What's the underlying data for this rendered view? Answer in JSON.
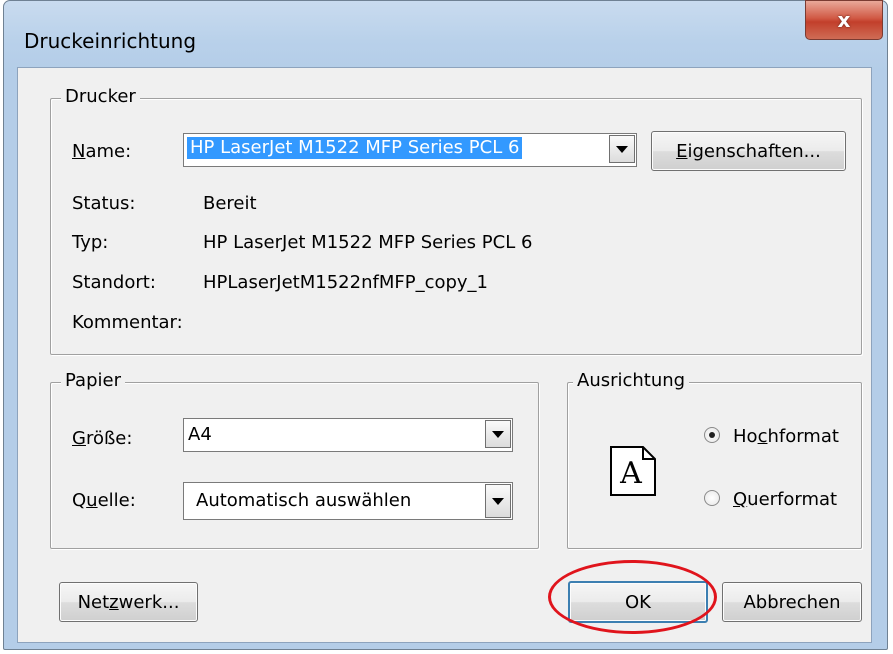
{
  "window": {
    "title": "Druckeinrichtung",
    "close_symbol": "x"
  },
  "printer_group": {
    "legend": "Drucker",
    "name_label": "Name:",
    "name_value": "HP LaserJet M1522 MFP Series PCL 6",
    "properties_button": "Eigenschaften...",
    "status_label": "Status:",
    "status_value": "Bereit",
    "type_label": "Typ:",
    "type_value": "HP LaserJet M1522 MFP Series PCL 6",
    "location_label": "Standort:",
    "location_value": "HPLaserJetM1522nfMFP_copy_1",
    "comment_label": "Kommentar:",
    "comment_value": ""
  },
  "paper_group": {
    "legend": "Papier",
    "size_label": "Größe:",
    "size_value": "A4",
    "source_label": "Quelle:",
    "source_value": "Automatisch auswählen"
  },
  "orientation_group": {
    "legend": "Ausrichtung",
    "page_icon_letter": "A",
    "portrait_label": "Hochformat",
    "landscape_label": "Querformat",
    "selected": "Hochformat"
  },
  "buttons": {
    "network": "Netzwerk...",
    "ok": "OK",
    "cancel": "Abbrechen"
  },
  "annotation": {
    "highlight_color": "#e0141c"
  }
}
